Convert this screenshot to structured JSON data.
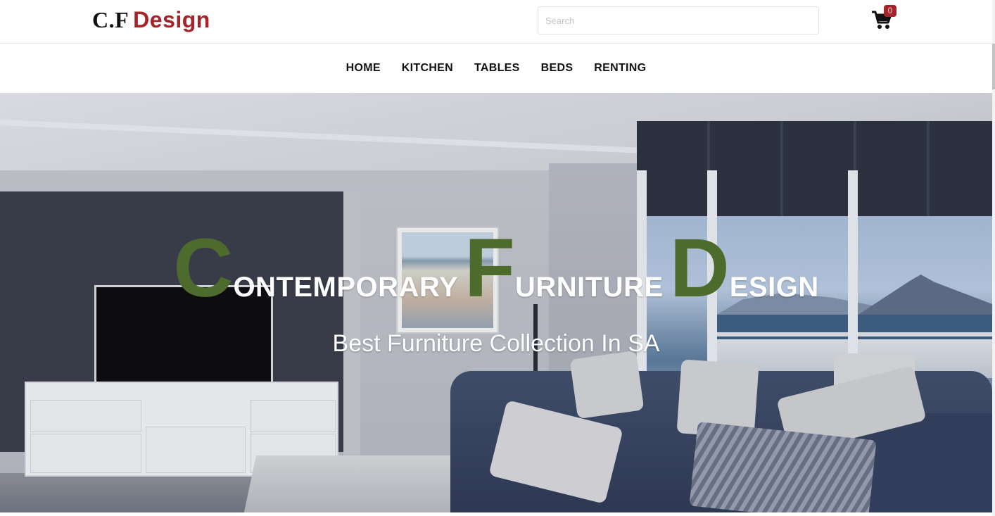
{
  "logo": {
    "part1": "C.F",
    "part2": "Design"
  },
  "search": {
    "placeholder": "Search",
    "value": ""
  },
  "cart": {
    "count": "0",
    "icon": "cart-icon"
  },
  "nav": {
    "items": [
      "HOME",
      "KITCHEN",
      "TABLES",
      "BEDS",
      "RENTING"
    ]
  },
  "hero": {
    "words": [
      {
        "initial": "C",
        "rest": "ONTEMPORARY"
      },
      {
        "initial": "F",
        "rest": "URNITURE"
      },
      {
        "initial": "D",
        "rest": "ESIGN"
      }
    ],
    "tagline": "Best Furniture Collection In SA"
  },
  "colors": {
    "brand": "#a3252a",
    "accent_green": "#4d6b2c",
    "badge": "#a3252a"
  }
}
